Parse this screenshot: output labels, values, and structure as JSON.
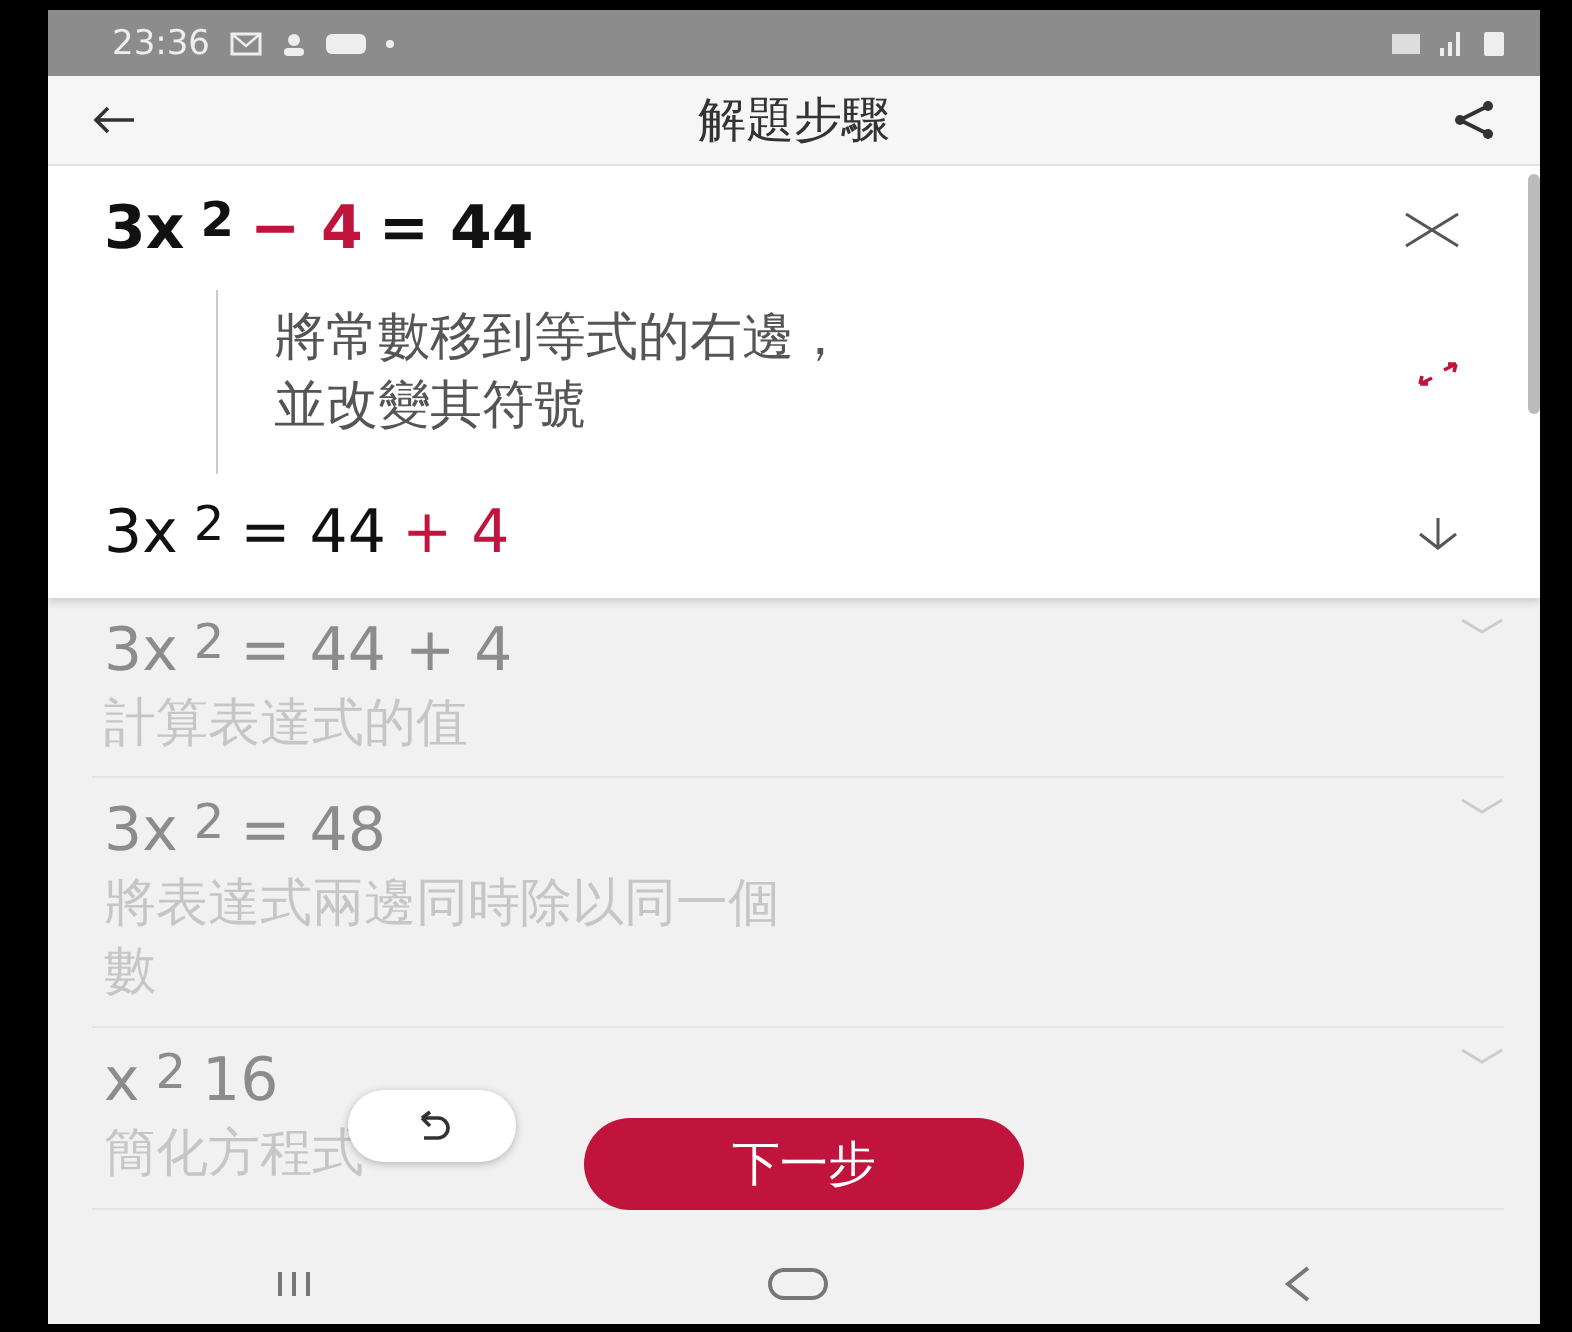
{
  "status_bar": {
    "time": "23:36"
  },
  "header": {
    "title": "解題步驟"
  },
  "current_step": {
    "equation": [
      {
        "text": "3x",
        "sup": false,
        "highlight": false
      },
      {
        "text": "2",
        "sup": true,
        "highlight": false
      },
      {
        "text": "− 4",
        "sup": false,
        "highlight": true
      },
      {
        "text": "= 44",
        "sup": false,
        "highlight": false
      }
    ],
    "description": "將常數移到等式的右邊，並改變其符號",
    "result": [
      {
        "text": "3x",
        "sup": false,
        "highlight": false
      },
      {
        "text": "2",
        "sup": true,
        "highlight": false
      },
      {
        "text": "= 44",
        "sup": false,
        "highlight": false
      },
      {
        "text": "+ 4",
        "sup": false,
        "highlight": true
      }
    ]
  },
  "steps": [
    {
      "equation": [
        {
          "text": "3x",
          "sup": false,
          "highlight": false
        },
        {
          "text": "2",
          "sup": true,
          "highlight": false
        },
        {
          "text": "= 44 + 4",
          "sup": false,
          "highlight": false
        }
      ],
      "description": "計算表達式的值"
    },
    {
      "equation": [
        {
          "text": "3x",
          "sup": false,
          "highlight": false
        },
        {
          "text": "2",
          "sup": true,
          "highlight": false
        },
        {
          "text": "= 48",
          "sup": false,
          "highlight": false
        }
      ],
      "description": "將表達式兩邊同時除以同一個數"
    },
    {
      "equation": [
        {
          "text": "x",
          "sup": false,
          "highlight": false
        },
        {
          "text": "2",
          "sup": true,
          "highlight": false
        },
        {
          "text": "16",
          "sup": false,
          "highlight": false
        }
      ],
      "description": "簡化方程式"
    }
  ],
  "next_button": {
    "label": "下一步"
  }
}
